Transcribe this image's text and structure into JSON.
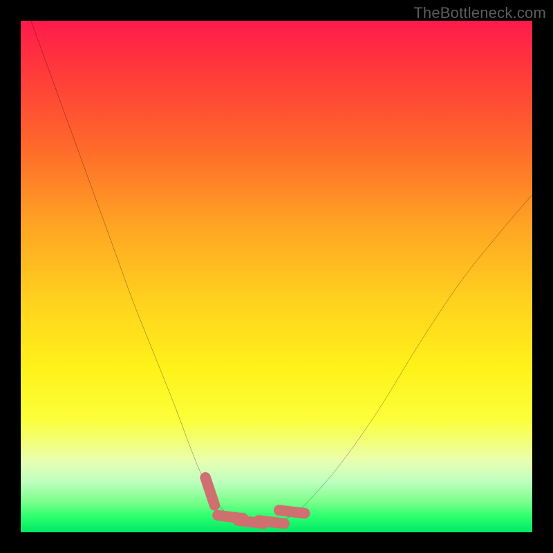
{
  "watermark": {
    "text": "TheBottleneck.com"
  },
  "colors": {
    "page_bg": "#000000",
    "curve": "#000000",
    "marker": "#cf6f6f",
    "gradient_top": "#ff1a4b",
    "gradient_bottom": "#00e865"
  },
  "chart_data": {
    "type": "line",
    "title": "",
    "xlabel": "",
    "ylabel": "",
    "xlim": [
      0,
      100
    ],
    "ylim": [
      0,
      100
    ],
    "grid": false,
    "legend": false,
    "series": [
      {
        "name": "bottleneck-curve",
        "x": [
          2,
          6,
          10,
          14,
          18,
          22,
          26,
          30,
          33,
          35,
          37,
          39,
          41,
          43,
          46,
          50,
          54,
          58,
          63,
          70,
          78,
          86,
          94,
          100
        ],
        "values": [
          100,
          89,
          78,
          67,
          56,
          45,
          35,
          25,
          17,
          12,
          8,
          5,
          3,
          2,
          2,
          2,
          4,
          8,
          14,
          24,
          37,
          49,
          59,
          66
        ]
      }
    ],
    "markers": [
      {
        "name": "optimal-range-left-marker",
        "x": 37,
        "y": 8
      },
      {
        "name": "optimal-range-right-marker",
        "x": 53,
        "y": 4
      },
      {
        "name": "optimal-range-bottom-1",
        "x": 41,
        "y": 3
      },
      {
        "name": "optimal-range-bottom-2",
        "x": 45,
        "y": 2
      },
      {
        "name": "optimal-range-bottom-3",
        "x": 49,
        "y": 2
      }
    ]
  }
}
